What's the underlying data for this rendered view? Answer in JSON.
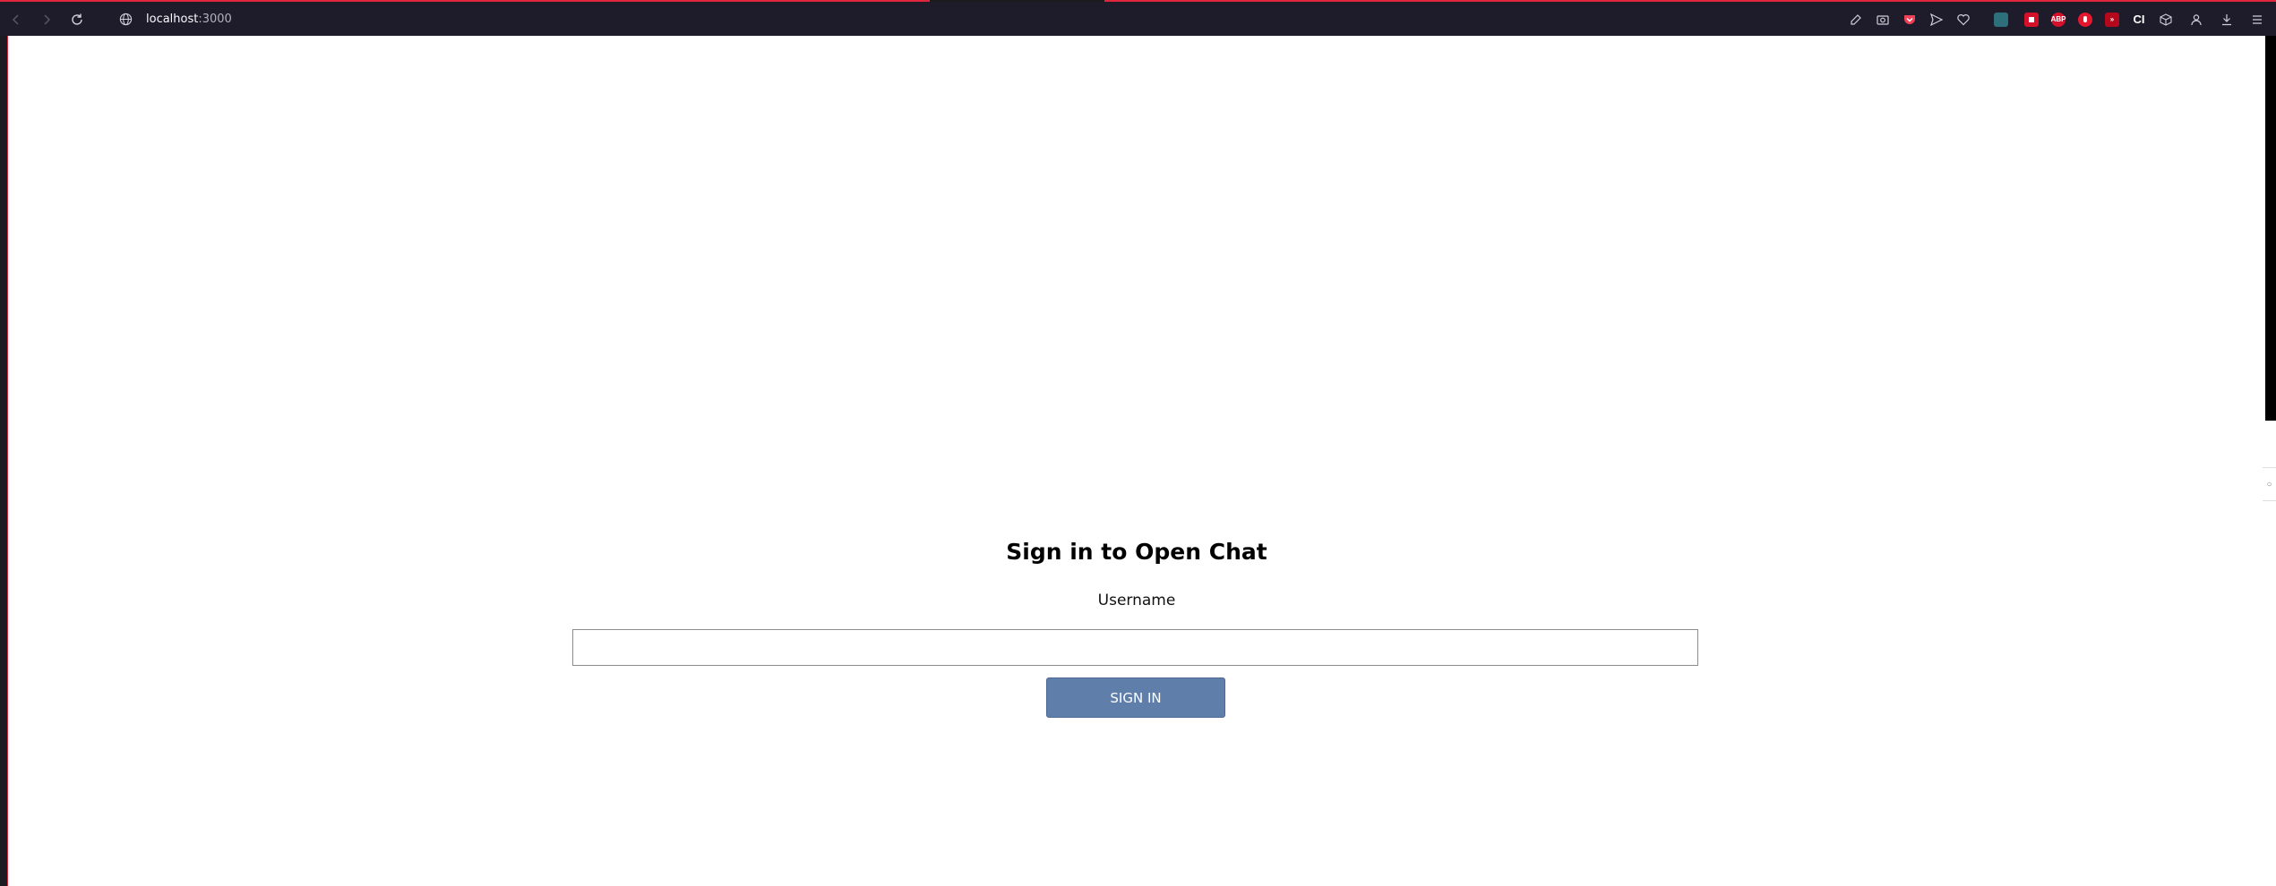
{
  "browser": {
    "url_host": "localhost",
    "url_port": ":3000",
    "nav": {
      "back_icon": "back-arrow-icon",
      "forward_icon": "forward-arrow-icon",
      "reload_icon": "reload-icon"
    },
    "toolbar_icons": [
      "edit-icon",
      "screenshot-icon",
      "pocket-icon",
      "send-icon",
      "heart-icon",
      "container-icon",
      "red-extension-icon",
      "abp-icon",
      "red-drop-icon",
      "red-box-icon",
      "ci-icon",
      "cube-icon",
      "account-icon",
      "download-icon",
      "menu-icon"
    ],
    "extension_labels": {
      "abp": "ABP",
      "ci": "CI"
    },
    "accent_color": "#e0263f"
  },
  "page": {
    "title": "Sign in to Open Chat",
    "username_label": "Username",
    "username_value": "",
    "sign_in_label": "SIGN IN",
    "button_color": "#5f7ea9"
  }
}
